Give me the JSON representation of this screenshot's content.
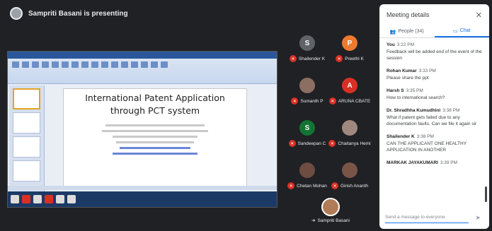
{
  "banner": {
    "presenter_text": "Sampriti Basani is presenting"
  },
  "slide": {
    "title_line1": "International Patent Application",
    "title_line2": "through PCT system"
  },
  "participants": [
    {
      "initial": "S",
      "name": "Shailender K",
      "color": "#5f6368"
    },
    {
      "initial": "P",
      "name": "Preethi K",
      "color": "#ee7a2f"
    },
    {
      "initial": "",
      "name": "Sumanth P",
      "color": "#8d6e63"
    },
    {
      "initial": "A",
      "name": "ARUNA CBATE",
      "color": "#d93025"
    },
    {
      "initial": "S",
      "name": "Sandeepan C",
      "color": "#137333"
    },
    {
      "initial": "",
      "name": "Chaitanya Hemi",
      "color": "#a1887f"
    },
    {
      "initial": "",
      "name": "Chetan Mohan",
      "color": "#6d4c41"
    },
    {
      "initial": "",
      "name": "Girish Ananth",
      "color": "#795548"
    }
  ],
  "self_tile": {
    "name": "Sampriti Basani"
  },
  "panel": {
    "title": "Meeting details",
    "tab_people": "People (34)",
    "tab_chat": "Chat",
    "messages": [
      {
        "who": "You",
        "time": "3:22 PM",
        "text": "Feedback will be added end of the event of the session"
      },
      {
        "who": "Rohan Kumar",
        "time": "3:33 PM",
        "text": "Please share the ppt"
      },
      {
        "who": "Harsh S",
        "time": "3:35 PM",
        "text": "How to international search?"
      },
      {
        "who": "Dr. Shradhha Kumudhini",
        "time": "3:38 PM",
        "text": "What if patent gets failed due to any documentation faults. Can we file it again sir"
      },
      {
        "who": "Shailender K",
        "time": "3:38 PM",
        "text": "CAN THE APPLICANT ONE HEALTHY APPLICATION IN ANOTHER"
      },
      {
        "who": "MARKAK JAYAKUMARI",
        "time": "3:39 PM",
        "text": ""
      }
    ],
    "composer_placeholder": "Send a message to everyone"
  }
}
